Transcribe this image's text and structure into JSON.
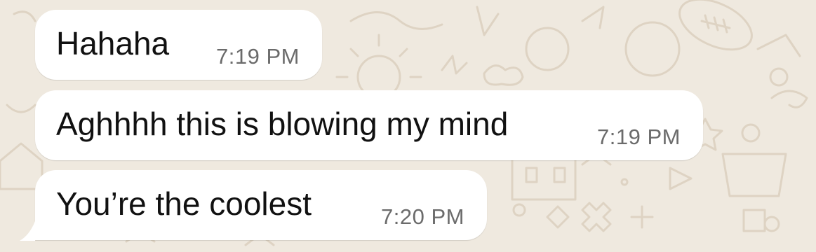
{
  "theme": {
    "wallpaper": "#efe9df",
    "doodle_stroke": "#ded3c3",
    "bubble": "#ffffff",
    "text": "#111111",
    "timestamp": "#6b6b6b"
  },
  "messages": [
    {
      "text": "Hahaha",
      "time": "7:19 PM"
    },
    {
      "text": "Aghhhh this is blowing my mind",
      "time": "7:19 PM"
    },
    {
      "text": "You’re the coolest",
      "time": "7:20 PM"
    }
  ]
}
